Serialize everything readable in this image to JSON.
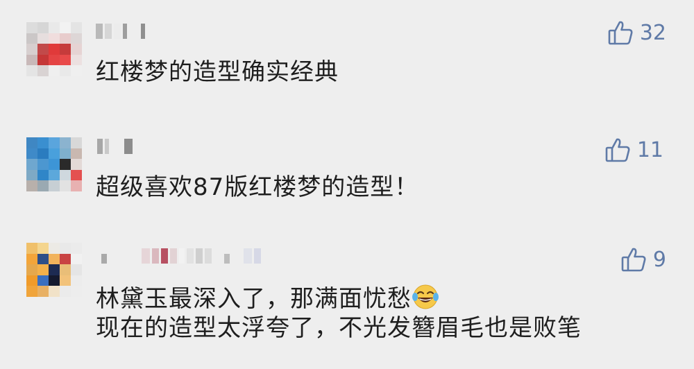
{
  "comments": [
    {
      "likes": "32",
      "text_lines": [
        "红楼梦的造型确实经典"
      ],
      "avatar_pixels": [
        "#dcdcdc",
        "#d6d6d6",
        "#e9e9e9",
        "#f2f2f2",
        "#e4e4e4",
        "#cbc7c7",
        "#e6dede",
        "#f0dddd",
        "#e8cccc",
        "#ddd6d6",
        "#d7cfcf",
        "#c24a4a",
        "#e03a3a",
        "#c63b3b",
        "#e6d3d3",
        "#c9b9b9",
        "#c53737",
        "#e44444",
        "#e84a4a",
        "#ece0e0",
        "#e4e4e4",
        "#d9d3d3",
        "#efefef",
        "#e9e9e9",
        "#efefef"
      ]
    },
    {
      "likes": "11",
      "text_lines": [
        "超级喜欢87版红楼梦的造型！"
      ],
      "avatar_pixels": [
        "#3f87c3",
        "#3a8fd0",
        "#5aa5dd",
        "#8bb3cf",
        "#d8d8d8",
        "#3f8ac8",
        "#2b7cbf",
        "#49a0dc",
        "#7fb0cd",
        "#c9b8b0",
        "#6fa7cf",
        "#4c97d0",
        "#3d95d6",
        "#2a2a2a",
        "#e3d9d6",
        "#7ea9c5",
        "#2f86c8",
        "#5ca8db",
        "#cfd8de",
        "#e45050",
        "#b8b0ab",
        "#9aa9b2",
        "#c7cfd4",
        "#e2e2e2",
        "#e8b1b1"
      ]
    },
    {
      "likes": "9",
      "text_lines": [
        "林黛玉最深入了，那满面忧愁",
        "现在的造型太浮夸了，不光发簪眉毛也是败笔"
      ],
      "avatar_pixels": [
        "#f0c06a",
        "#f4d58e",
        "#eceae5",
        "#e9e9e9",
        "#ebebeb",
        "#f3a53a",
        "#2e4f88",
        "#f2b35c",
        "#c94343",
        "#f1f1f1",
        "#e6a84c",
        "#f4b14a",
        "#1d2b52",
        "#e9be78",
        "#e5e5e5",
        "#f09b2a",
        "#3b6fbf",
        "#151a2e",
        "#f2c27a",
        "#ececec",
        "#f0a43a",
        "#e8b063",
        "#f1e2c8",
        "#ebebeb",
        "#ededed"
      ]
    }
  ],
  "icons": {
    "like": "thumbs-up-icon",
    "emoji": "tears-of-joy-emoji"
  },
  "colors": {
    "background": "#eeeeee",
    "like": "#5f7aa7",
    "text": "#1e1e1e"
  }
}
